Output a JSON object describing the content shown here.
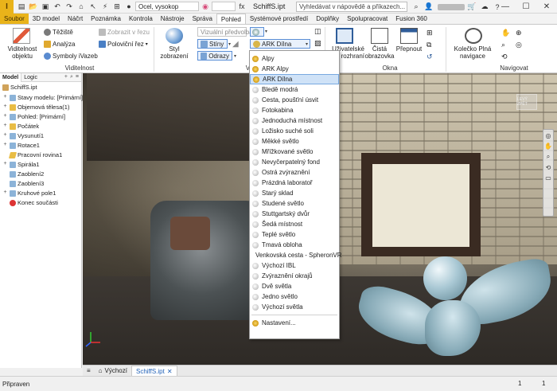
{
  "titlebar": {
    "logo": "I",
    "material_combo": "Ocel, vysokop",
    "doc_title": "SchiffS.ipt",
    "search_placeholder": "Vyhledávat v nápovědě a příkazech...",
    "minimize": "—",
    "maximize": "☐",
    "close": "✕"
  },
  "ribbon_tabs": [
    "Soubor",
    "3D model",
    "Náčrt",
    "Poznámka",
    "Kontrola",
    "Nástroje",
    "Správa",
    "Pohled",
    "Systémové prostředí",
    "Doplňky",
    "Spolupracovat",
    "Fusion 360"
  ],
  "ribbon": {
    "visibility": {
      "big_button": "Viditelnost objektu",
      "teziste": "Těžiště",
      "analyza": "Analýza",
      "symboly": "Symboly iVazeb",
      "zobrazit_v_rezu": "Zobrazit v řezu",
      "polovicni_rez": "Poloviční řez",
      "label": "Viditelnost"
    },
    "appearance": {
      "styl_zobrazeni": "Styl zobrazení",
      "vizualni_predvolba": "Vizuální předvolba",
      "stiny": "Stíny",
      "odrazy": "Odrazy",
      "lighting_selected": "ARK Dílna",
      "label": "Vzhled"
    },
    "window": {
      "uzivatelske": "Uživatelské rozhraní",
      "cista": "Čistá obrazovka",
      "prepnout": "Přepnout",
      "label": "Okna"
    },
    "navigate": {
      "kolecko": "Kolečko Plná navigace",
      "label": "Navigovat"
    }
  },
  "browser": {
    "tabs": [
      "Model",
      "Logic"
    ],
    "items": [
      "SchiffS.ipt",
      "Stavy modelu: [Primární]",
      "Objemová tělesa(1)",
      "Pohled: [Primární]",
      "Počátek",
      "Vysunutí1",
      "Rotace1",
      "Pracovní rovina1",
      "Spirála1",
      "Zaoblení2",
      "Zaoblení3",
      "Kruhové pole1",
      "Konec součásti"
    ]
  },
  "lighting_menu": {
    "items": [
      "Alpy",
      "ARK Alpy",
      "ARK Dílna",
      "Bledě modrá",
      "Cesta, poušťní úsvit",
      "Fotokabina",
      "Jednoduchá místnost",
      "Ložisko suché soli",
      "Měkké světlo",
      "Mřížkované světlo",
      "Nevyčerpatelný fond",
      "Ostrá zvýraznění",
      "Prázdná laboratoř",
      "Starý sklad",
      "Studené světlo",
      "Stuttgartský dvůr",
      "Šedá místnost",
      "Teplé světlo",
      "Tmavá obloha",
      "Venkovská cesta - SpheronVR",
      "Výchozí IBL",
      "Zvýraznění okrajů",
      "Dvě světla",
      "Jedno světlo",
      "Výchozí světla"
    ],
    "selected": "ARK Dílna",
    "settings": "Nastavení..."
  },
  "viewport": {
    "viewcube": "LEVÝ ZPĚT"
  },
  "doc_tabs": {
    "home": "Výchozí",
    "doc": "SchiffS.ipt",
    "close": "✕"
  },
  "status": {
    "text": "Připraven",
    "num1": "1",
    "num2": "1"
  }
}
